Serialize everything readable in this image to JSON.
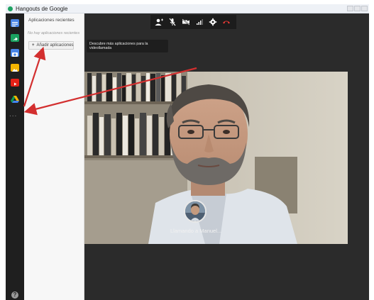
{
  "window": {
    "title": "Hangouts de Google",
    "icon": "hangouts-icon"
  },
  "rail": {
    "icons": [
      "chat-icon",
      "screen-share-icon",
      "camera-icon",
      "photo-icon",
      "youtube-icon",
      "drive-icon"
    ],
    "more_label": "...",
    "help_label": "?"
  },
  "apps_panel": {
    "title": "Aplicaciones recientes",
    "empty_text": "No hay aplicaciones recientes",
    "add_button_label": "Añadir aplicaciones"
  },
  "toolbar": {
    "buttons": [
      "add-person-icon",
      "mic-off-icon",
      "camera-off-icon",
      "signal-icon",
      "settings-icon",
      "hang-up-icon"
    ]
  },
  "discover_tooltip": "Descubre más aplicaciones para la videollamada",
  "call": {
    "status_text": "Llamando a Manuel..."
  },
  "colors": {
    "rail_bg": "#1f1f1f",
    "call_bg": "#2b2b2b",
    "annotation_arrow": "#d32f2f",
    "hangup_red": "#e53935"
  }
}
